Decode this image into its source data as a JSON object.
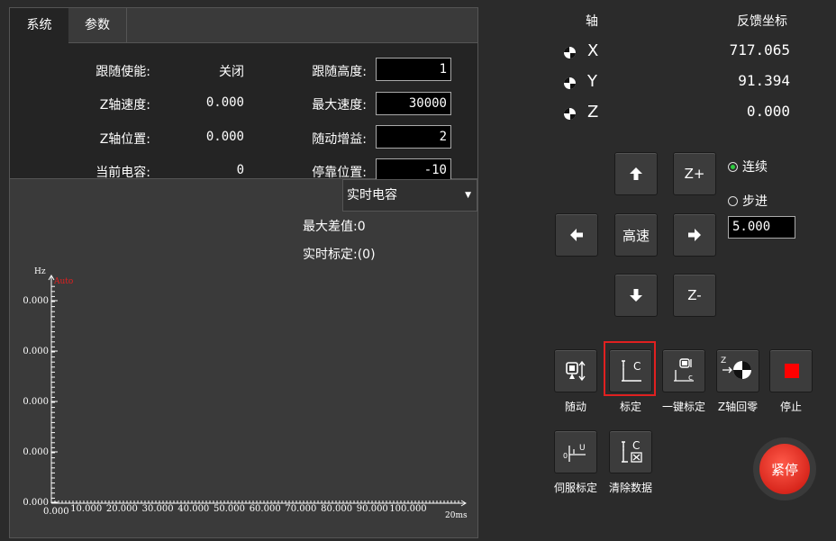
{
  "tabs": [
    {
      "label": "系统",
      "active": true
    },
    {
      "label": "参数",
      "active": false
    }
  ],
  "params": {
    "follow_enable": {
      "label": "跟随使能:",
      "value": "关闭"
    },
    "follow_height": {
      "label": "跟随高度:",
      "value": "1"
    },
    "z_speed": {
      "label": "Z轴速度:",
      "value": "0.000"
    },
    "max_speed": {
      "label": "最大速度:",
      "value": "30000"
    },
    "z_position": {
      "label": "Z轴位置:",
      "value": "0.000"
    },
    "follow_gain": {
      "label": "随动增益:",
      "value": "2"
    },
    "current_cap": {
      "label": "当前电容:",
      "value": "0"
    },
    "park_position": {
      "label": "停靠位置:",
      "value": "-10"
    }
  },
  "chart_select": {
    "value": "实时电容"
  },
  "stats": {
    "max_diff": "最大差值:0",
    "realtime_calib": "实时标定:(0)"
  },
  "chart_data": {
    "type": "line",
    "ylabel": "Hz",
    "xunit": "20ms",
    "auto_label": "Auto",
    "y_tick_labels": [
      "0.000",
      "0.000",
      "0.000",
      "0.000",
      "0.000"
    ],
    "x_tick_labels": [
      "0.000",
      "10.000",
      "20.000",
      "30.000",
      "40.000",
      "50.000",
      "60.000",
      "70.000",
      "80.000",
      "90.000",
      "100.000"
    ],
    "x": [],
    "y": []
  },
  "axes_panel": {
    "header_axis": "轴",
    "header_feedback": "反馈坐标",
    "rows": [
      {
        "name": "X",
        "value": "717.065"
      },
      {
        "name": "Y",
        "value": "91.394"
      },
      {
        "name": "Z",
        "value": "0.000"
      }
    ]
  },
  "jog": {
    "fast": "高速",
    "z_plus": "Z+",
    "z_minus": "Z-",
    "mode_continuous": "连续",
    "mode_step": "步进",
    "step_value": "5.000",
    "continuous_selected": true
  },
  "tools": {
    "follow": "随动",
    "calibrate": "标定",
    "one_key_calibrate": "一键标定",
    "z_home": "Z轴回零",
    "stop": "停止",
    "servo_calibrate": "伺服标定",
    "clear_data": "清除数据"
  },
  "estop": {
    "label": "紧停"
  },
  "colors": {
    "accent_red": "#e02020",
    "stop_red": "#ff0000",
    "radio_green": "#2ecc40"
  }
}
